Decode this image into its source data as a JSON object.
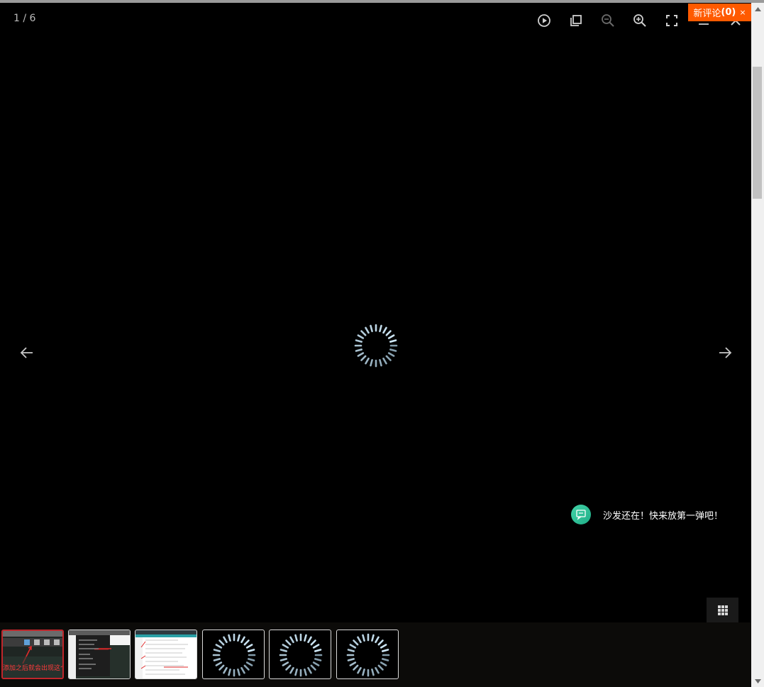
{
  "viewer": {
    "counter": "1 / 6",
    "background_color": "#000000",
    "accent_color": "#ff5a00"
  },
  "toolbar": {
    "buttons": [
      {
        "name": "play-icon"
      },
      {
        "name": "copy-icon"
      },
      {
        "name": "zoom-out-icon"
      },
      {
        "name": "zoom-in-icon"
      },
      {
        "name": "fullscreen-icon"
      },
      {
        "name": "menu-icon"
      },
      {
        "name": "close-icon"
      }
    ]
  },
  "new_comment": {
    "label": "新评论",
    "count": "(0)",
    "close": "×"
  },
  "navigation": {
    "prev_icon": "arrow-left-icon",
    "next_icon": "arrow-right-icon"
  },
  "comments": {
    "empty_text": "沙发还在！快来放第一弹吧！",
    "icon": "comment-bubble-icon"
  },
  "thumbnails": {
    "total": 6,
    "active_index": 0,
    "items": [
      {
        "state": "image",
        "caption": "添加之后就会出现这个"
      },
      {
        "state": "image",
        "caption": ""
      },
      {
        "state": "image",
        "caption": ""
      },
      {
        "state": "loading"
      },
      {
        "state": "loading"
      },
      {
        "state": "loading"
      }
    ],
    "grid_icon": "grid-icon"
  }
}
